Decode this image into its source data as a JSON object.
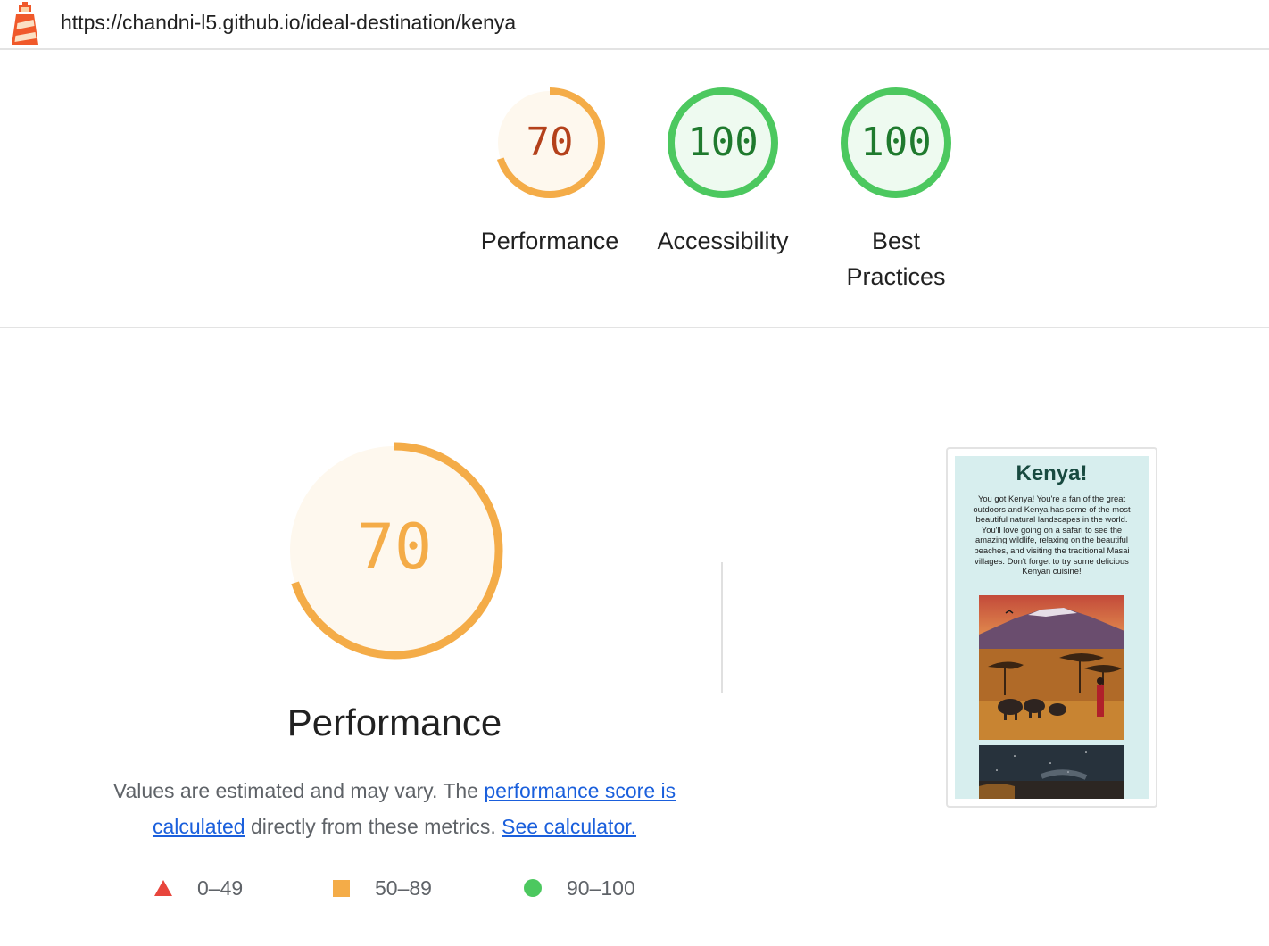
{
  "header": {
    "url": "https://chandni-l5.github.io/ideal-destination/kenya",
    "logo_icon": "lighthouse-icon"
  },
  "scores": [
    {
      "label": "Performance",
      "value": "70",
      "score": 70,
      "color": "#f4ac48",
      "text_color": "#b4411b",
      "fill": "#fef8ee"
    },
    {
      "label": "Accessibility",
      "value": "100",
      "score": 100,
      "color": "#4cc85f",
      "text_color": "#1f7a2e",
      "fill": "#eefaf0"
    },
    {
      "label": "Best Practices",
      "value": "100",
      "score": 100,
      "color": "#4cc85f",
      "text_color": "#1f7a2e",
      "fill": "#eefaf0"
    }
  ],
  "performance": {
    "title": "Performance",
    "score_text": "70",
    "score": 70,
    "color": "#f4ac48",
    "desc_prefix": "Values are estimated and may vary. The ",
    "desc_link1": "performance score is calculated",
    "desc_middle": " directly from these metrics. ",
    "desc_link2": "See calculator."
  },
  "legend": [
    {
      "range": "0–49",
      "icon": "red-triangle-icon",
      "color": "#e8453c"
    },
    {
      "range": "50–89",
      "icon": "orange-square-icon",
      "color": "#f4ac48"
    },
    {
      "range": "90–100",
      "icon": "green-circle-icon",
      "color": "#4cc85f"
    }
  ],
  "screenshot": {
    "title": "Kenya!",
    "text": "You got Kenya! You're a fan of the great outdoors and Kenya has some of the most beautiful natural landscapes in the world. You'll love going on a safari to see the amazing wildlife, relaxing on the beautiful beaches, and visiting the traditional Masai villages. Don't forget to try some delicious Kenyan cuisine!"
  }
}
